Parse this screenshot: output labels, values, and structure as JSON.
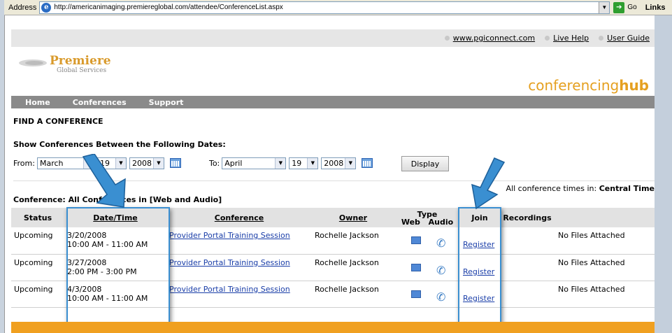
{
  "browser": {
    "address_label": "Address",
    "url": "http://americanimaging.premiereglobal.com/attendee/ConferenceList.aspx",
    "go_label": "Go",
    "links_label": "Links"
  },
  "toplinks": [
    "www.pgiconnect.com",
    "Live Help",
    "User Guide"
  ],
  "logo": {
    "brand": "Premiere",
    "sub": "Global Services"
  },
  "hub": {
    "light": "conferencing",
    "bold": "hub"
  },
  "nav": [
    "Home",
    "Conferences",
    "Support"
  ],
  "find_heading": "FIND A CONFERENCE",
  "show_heading": "Show Conferences Between the Following Dates:",
  "from": {
    "label": "From:",
    "month": "March",
    "day": "19",
    "year": "2008"
  },
  "to": {
    "label": "To:",
    "month": "April",
    "day": "19",
    "year": "2008"
  },
  "display_button": "Display",
  "conference_filter": "Conference: All Conferences in [Web and Audio]",
  "times_note": {
    "prefix": "All conference times in:",
    "zone": "Central Time"
  },
  "table": {
    "headers": {
      "status": "Status",
      "datetime": "Date/Time",
      "conference": "Conference",
      "owner": "Owner",
      "type": "Type",
      "web": "Web",
      "audio": "Audio",
      "join": "Join",
      "recordings": "Recordings"
    },
    "rows": [
      {
        "status": "Upcoming",
        "date": "3/20/2008",
        "time": "10:00 AM - 11:00 AM",
        "conference": "Provider Portal Training Session",
        "owner": "Rochelle Jackson",
        "join": "Register",
        "recordings": "No Files Attached"
      },
      {
        "status": "Upcoming",
        "date": "3/27/2008",
        "time": "2:00 PM - 3:00 PM",
        "conference": "Provider Portal Training Session",
        "owner": "Rochelle Jackson",
        "join": "Register",
        "recordings": "No Files Attached"
      },
      {
        "status": "Upcoming",
        "date": "4/3/2008",
        "time": "10:00 AM - 11:00 AM",
        "conference": "Provider Portal Training Session",
        "owner": "Rochelle Jackson",
        "join": "Register",
        "recordings": "No Files Attached"
      }
    ]
  },
  "colors": {
    "accent_orange": "#e5a020",
    "highlight_blue": "#3a8fd1",
    "nav_gray": "#8a8a8a"
  }
}
